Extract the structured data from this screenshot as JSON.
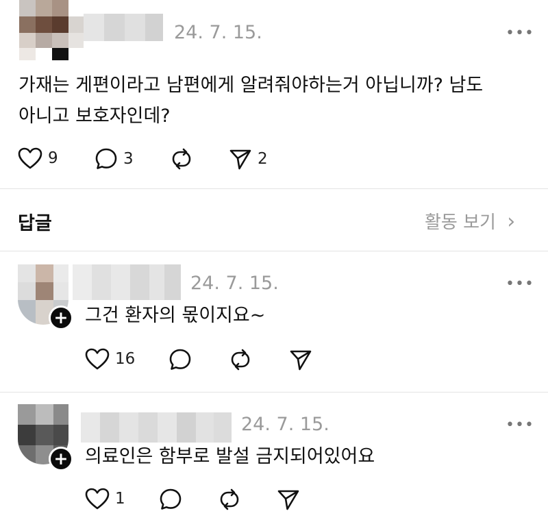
{
  "post": {
    "timestamp": "24. 7. 15.",
    "more": "•••",
    "text_line1": "가재는 게편이라고 남편에게 알려줘야하는거 아닙니까? 남도",
    "text_line2": "아니고 보호자인데?",
    "likes": "9",
    "comments": "3",
    "shares": "2"
  },
  "replies_header": {
    "title": "답글",
    "activity_link": "활동 보기",
    "chevron": "›"
  },
  "replies": [
    {
      "timestamp": "24. 7. 15.",
      "more": "•••",
      "text": "그건 환자의 몫이지요~",
      "likes": "16",
      "plus": "+"
    },
    {
      "timestamp": "24. 7. 15.",
      "more": "•••",
      "text": "의료인은 함부로 발설 금지되어있어요",
      "likes": "1",
      "plus": "+"
    }
  ],
  "icons": [
    "heart-icon",
    "comment-icon",
    "repost-icon",
    "send-icon",
    "more-icon",
    "follow-plus-icon"
  ]
}
